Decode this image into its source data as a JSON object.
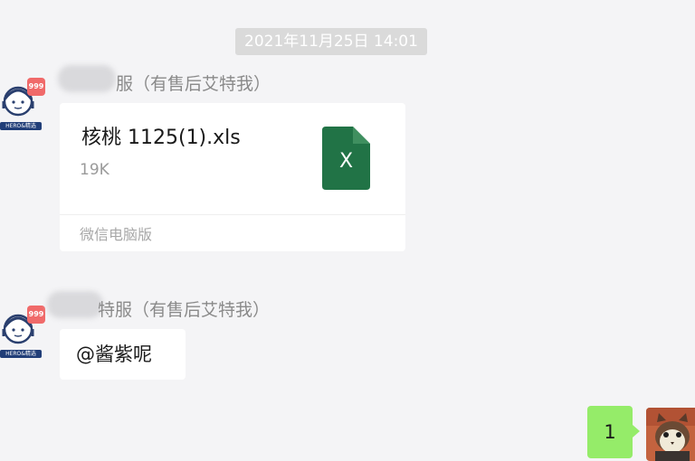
{
  "chat": {
    "timestamp": "2021年11月25日 14:01",
    "messages": [
      {
        "sender_name": "服（有售后艾特我）",
        "avatar_badge": "999",
        "avatar_tag": "HERO&精选",
        "type": "file",
        "file": {
          "name": "核桃 1125(1).xls",
          "size": "19K",
          "source": "微信电脑版",
          "icon": "excel-file-icon",
          "icon_letter": "X",
          "icon_color": "#217346"
        }
      },
      {
        "sender_name": "特服（有售后艾特我）",
        "avatar_badge": "999",
        "avatar_tag": "HERO&精选",
        "type": "text",
        "text": "@酱紫呢"
      },
      {
        "type": "text",
        "outgoing": true,
        "text": "1",
        "bubble_color": "#95ec69",
        "avatar": "user-avatar-cat"
      }
    ]
  }
}
